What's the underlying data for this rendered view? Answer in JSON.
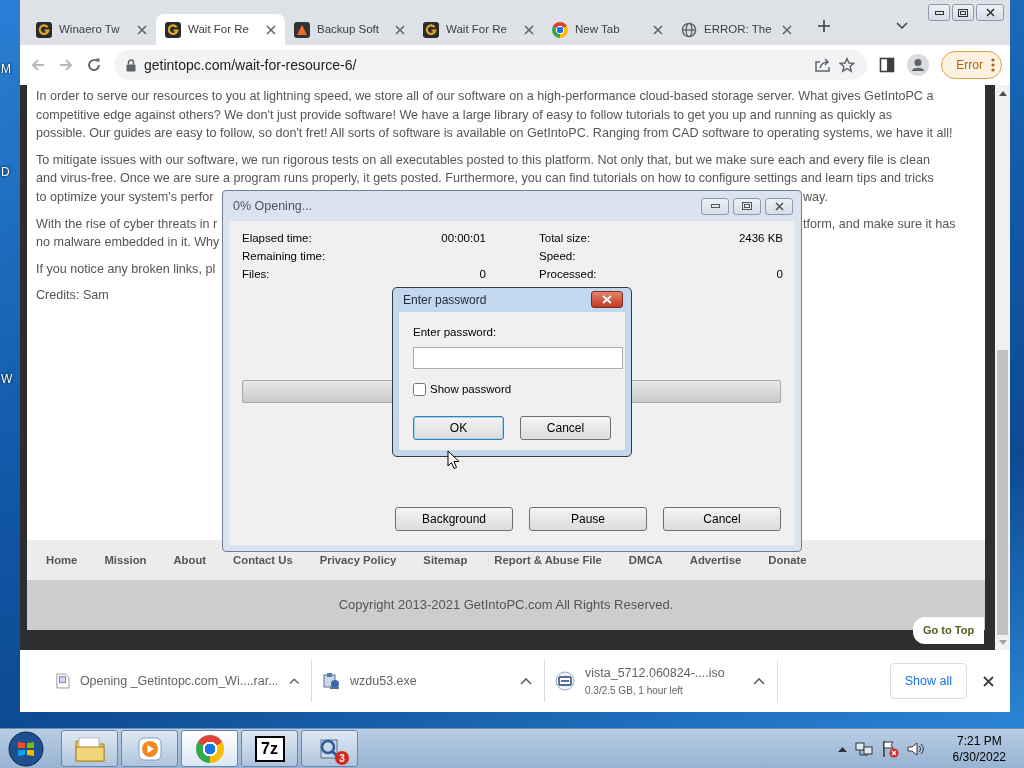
{
  "desktop": {
    "labels": [
      "M",
      "D",
      "W"
    ]
  },
  "browser": {
    "tabs": [
      {
        "title": "Winaero Tw",
        "kind": "getintopc",
        "selected": false
      },
      {
        "title": "Wait For Re",
        "kind": "getintopc",
        "selected": true
      },
      {
        "title": "Backup Soft",
        "kind": "backup",
        "selected": false
      },
      {
        "title": "Wait For Re",
        "kind": "getintopc",
        "selected": false
      },
      {
        "title": "New Tab",
        "kind": "chrome",
        "selected": false
      },
      {
        "title": "ERROR: The",
        "kind": "globe",
        "selected": false
      }
    ],
    "url": "getintopc.com/wait-for-resource-6/",
    "profile_status": "Error"
  },
  "page": {
    "paragraphs": [
      {
        "lines": [
          {
            "text": "In order to serve our resources to you at lightning speed, we store all of our software on a high-performance cloud-based storage server. What gives GetIntoPC a"
          },
          {
            "text": "competitive edge against others? We don't just provide software! We have a large library of easy to follow tutorials to get you up and running as quickly as"
          },
          {
            "text": "possible. Our guides are easy to follow, so don't fret! All sorts of software is available on GetIntoPC. Ranging from CAD software to operating systems, we have it all!"
          }
        ]
      },
      {
        "lines": [
          {
            "text": "To mitigate issues with our software, we run rigorous tests on all executables posted to this platform. Not only that, but we make sure each and every file is clean"
          },
          {
            "text": "and virus-free. Once we are sure a program runs properly, it gets posted. Furthermore, you can find tutorials on how to configure settings and learn tips and tricks"
          },
          {
            "text": "to optimize your system's perfor",
            "tail": "way."
          }
        ]
      },
      {
        "lines": [
          {
            "text": "With the rise of cyber threats in r",
            "tail": "tform, and make sure it has"
          },
          {
            "text": "no malware embedded in it. Why"
          }
        ]
      },
      {
        "lines": [
          {
            "text": "If you notice any broken links, pl"
          }
        ]
      },
      {
        "lines": [
          {
            "text": "Credits: Sam"
          }
        ]
      }
    ],
    "footer_links": [
      "Home",
      "Mission",
      "About",
      "Contact Us",
      "Privacy Policy",
      "Sitemap",
      "Report & Abuse File",
      "DMCA",
      "Advertise",
      "Donate"
    ],
    "copyright": "Copyright 2013-2021 GetIntoPC.com All Rights Reserved.",
    "go_to_top": "Go to Top"
  },
  "extract_dialog": {
    "title": "0% Opening...",
    "stats": [
      {
        "label": "Elapsed time:",
        "value": "00:00:01"
      },
      {
        "label": "Total size:",
        "value": "2436 KB"
      },
      {
        "label": "Remaining time:"
      },
      {
        "label": "Speed:"
      },
      {
        "label": "Files:",
        "value": "0"
      },
      {
        "label": "Processed:",
        "value": "0"
      }
    ],
    "progress": {
      "level": 0
    },
    "buttons": [
      "Background",
      "Pause",
      "Cancel"
    ]
  },
  "password_dialog": {
    "title": "Enter password",
    "prompt": "Enter password:",
    "show_password": {
      "label": "Show password",
      "checked": false
    },
    "buttons": [
      {
        "label": "OK",
        "default": true
      },
      {
        "label": "Cancel",
        "default": false
      }
    ]
  },
  "downloads": {
    "items": [
      {
        "kind": "archive",
        "name": "Opening _Getintopc.com_Wi....rar..."
      },
      {
        "kind": "installer",
        "name": "wzdu53.exe"
      },
      {
        "kind": "disc",
        "name": "vista_5712.060824-....iso",
        "detail": "0.3/2.5 GB, 1 hour left"
      }
    ],
    "show_all": "Show all"
  },
  "taskbar": {
    "apps": [
      {
        "kind": "explorer",
        "active": false
      },
      {
        "kind": "media",
        "active": false
      },
      {
        "kind": "chrome",
        "active": true
      },
      {
        "kind": "sevenzip",
        "label": "7z",
        "active": false
      },
      {
        "kind": "installer",
        "badge": "3",
        "active": false
      }
    ],
    "time": "7:21 PM",
    "date": "6/30/2022"
  }
}
